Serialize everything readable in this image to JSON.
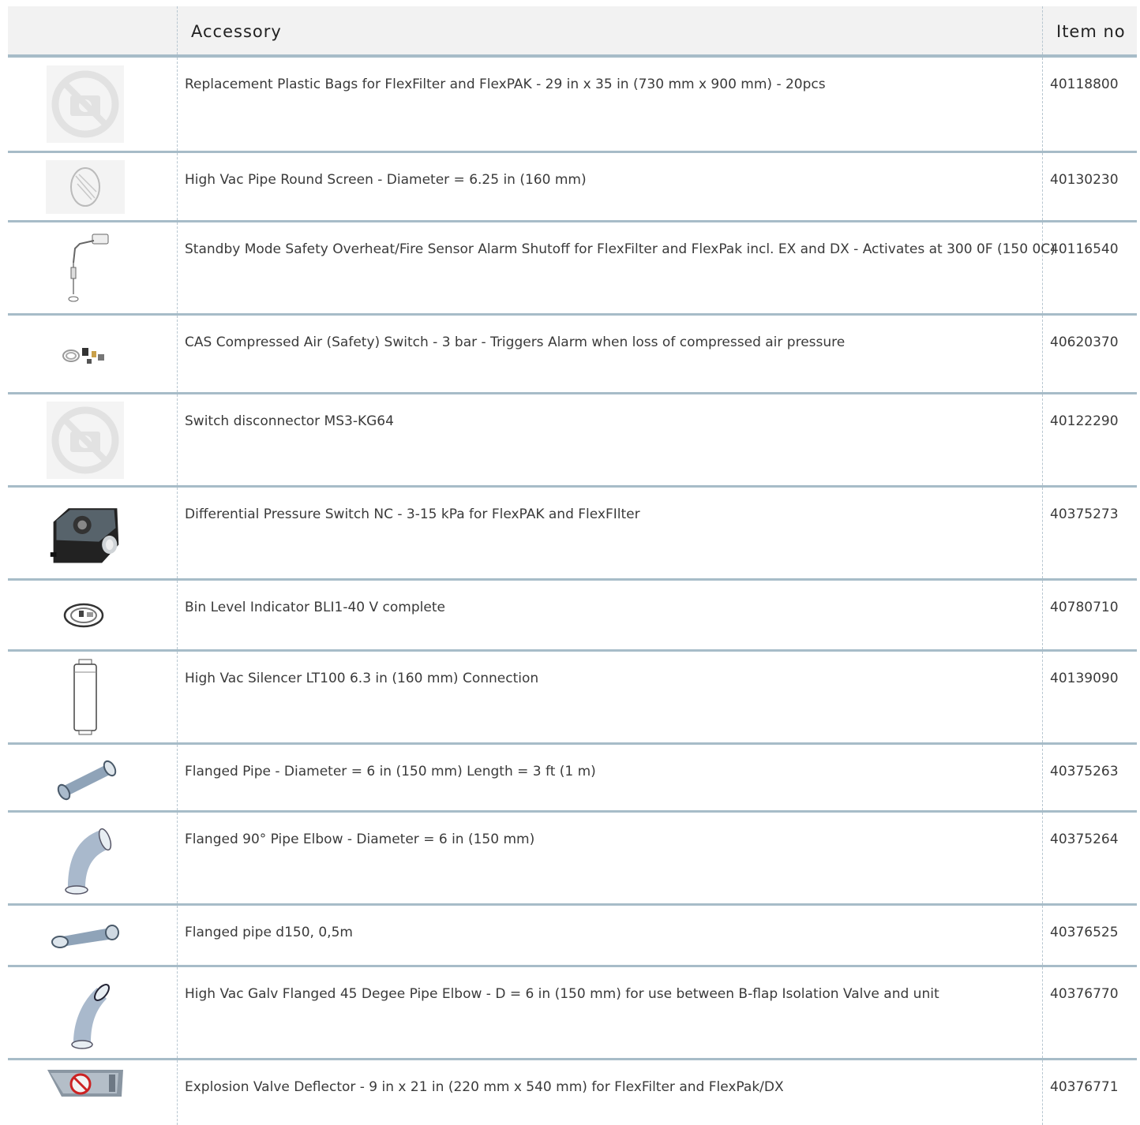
{
  "header": {
    "col_accessory": "Accessory",
    "col_item": "Item no"
  },
  "rows": [
    {
      "desc": "Replacement Plastic Bags for FlexFilter and FlexPAK - 29 in x 35 in (730 mm x 900 mm) - 20pcs",
      "item": "40118800",
      "icon": "no-image-icon"
    },
    {
      "desc": "High Vac Pipe Round Screen - Diameter = 6.25 in (160 mm)",
      "item": "40130230",
      "icon": "round-screen-icon"
    },
    {
      "desc": "Standby Mode Safety Overheat/Fire Sensor Alarm Shutoff for FlexFilter and FlexPak incl. EX and DX - Activates at 300 0F (150 0C)",
      "item": "40116540",
      "icon": "fire-sensor-icon"
    },
    {
      "desc": "CAS Compressed Air (Safety) Switch - 3 bar - Triggers Alarm when loss of compressed air pressure",
      "item": "40620370",
      "icon": "air-switch-icon"
    },
    {
      "desc": "Switch disconnector MS3-KG64",
      "item": "40122290",
      "icon": "no-image-icon"
    },
    {
      "desc": "Differential Pressure Switch NC - 3-15 kPa for FlexPAK and FlexFIlter",
      "item": "40375273",
      "icon": "pressure-switch-icon"
    },
    {
      "desc": "Bin Level Indicator BLI1-40 V complete",
      "item": "40780710",
      "icon": "bin-level-icon"
    },
    {
      "desc": "High Vac Silencer LT100 6.3 in (160 mm) Connection",
      "item": "40139090",
      "icon": "silencer-icon"
    },
    {
      "desc": "Flanged Pipe - Diameter = 6 in (150 mm) Length = 3 ft (1 m)",
      "item": "40375263",
      "icon": "flanged-pipe-icon"
    },
    {
      "desc": "Flanged 90° Pipe Elbow - Diameter = 6 in (150 mm)",
      "item": "40375264",
      "icon": "elbow-90-icon"
    },
    {
      "desc": "Flanged pipe d150, 0,5m",
      "item": "40376525",
      "icon": "short-pipe-icon"
    },
    {
      "desc": "High Vac Galv Flanged 45 Degee Pipe Elbow - D = 6 in (150 mm) for use between B-flap Isolation Valve and unit",
      "item": "40376770",
      "icon": "elbow-45-icon"
    },
    {
      "desc": "Explosion Valve Deflector - 9 in x 21 in (220 mm x 540 mm) for FlexFilter and FlexPak/DX",
      "item": "40376771",
      "icon": "deflector-icon"
    }
  ]
}
